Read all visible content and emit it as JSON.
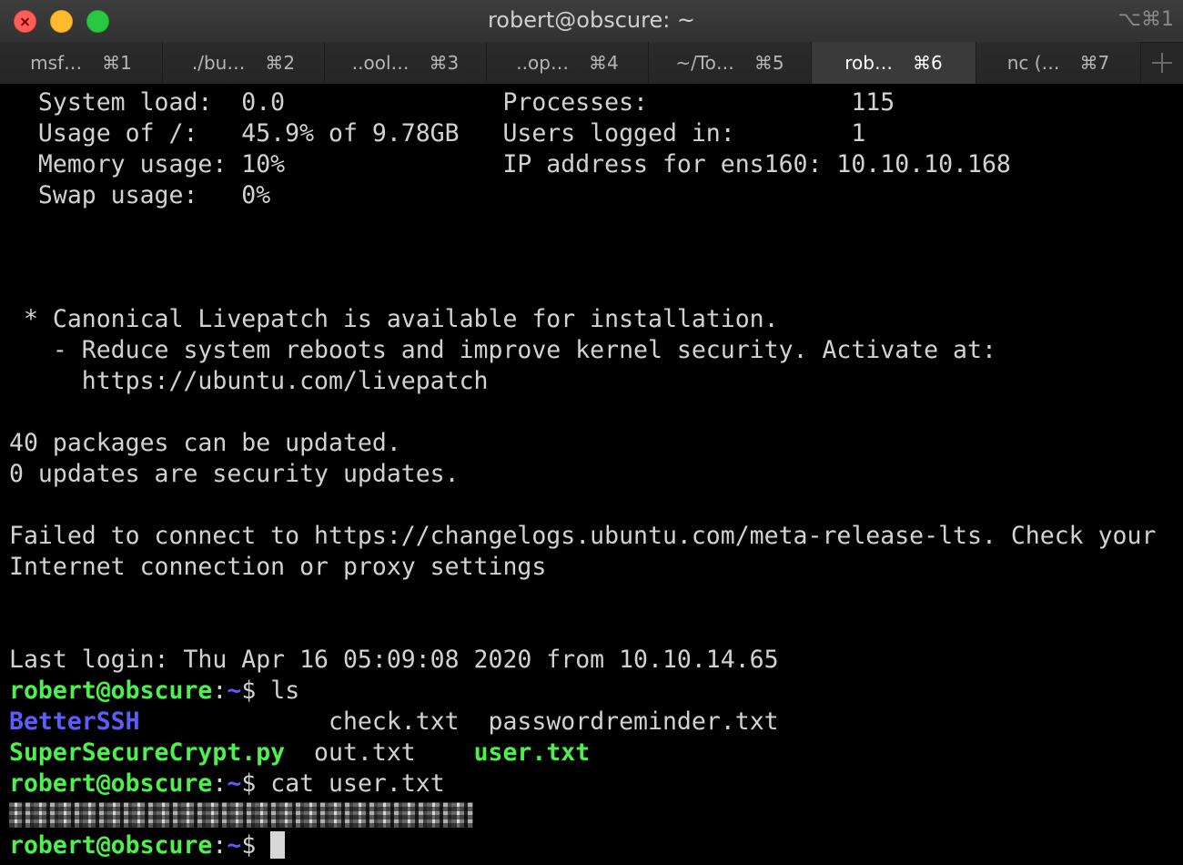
{
  "window": {
    "title": "robert@obscure: ~",
    "shortcut": "⌥⌘1"
  },
  "tabs": [
    {
      "label": "msf…",
      "key": "⌘1"
    },
    {
      "label": "./bu…",
      "key": "⌘2"
    },
    {
      "label": "..ool…",
      "key": "⌘3"
    },
    {
      "label": "..op…",
      "key": "⌘4"
    },
    {
      "label": "~/To…",
      "key": "⌘5"
    },
    {
      "label": "rob…",
      "key": "⌘6"
    },
    {
      "label": "nc (…",
      "key": "⌘7"
    }
  ],
  "terminal": {
    "sysinfo": [
      "  System load:  0.0               Processes:              115",
      "  Usage of /:   45.9% of 9.78GB   Users logged in:        1",
      "  Memory usage: 10%               IP address for ens160: 10.10.10.168",
      "  Swap usage:   0%"
    ],
    "livepatch": [
      " * Canonical Livepatch is available for installation.",
      "   - Reduce system reboots and improve kernel security. Activate at:",
      "     https://ubuntu.com/livepatch"
    ],
    "updates": [
      "40 packages can be updated.",
      "0 updates are security updates."
    ],
    "failed": [
      "Failed to connect to https://changelogs.ubuntu.com/meta-release-lts. Check your",
      "Internet connection or proxy settings"
    ],
    "last_login": "Last login: Thu Apr 16 05:09:08 2020 from 10.10.14.65",
    "prompt_user": "robert@obscure",
    "prompt_sep": ":",
    "prompt_path": "~",
    "prompt_dollar": "$ ",
    "cmd1": "ls",
    "cmd2": "cat user.txt",
    "ls": {
      "row1_a": "BetterSSH",
      "row1_pad": "             ",
      "row1_b": "check.txt  passwordreminder.txt",
      "row2_a": "SuperSecureCrypt.py",
      "row2_mid": "  out.txt    ",
      "row2_b": "user.txt"
    }
  }
}
